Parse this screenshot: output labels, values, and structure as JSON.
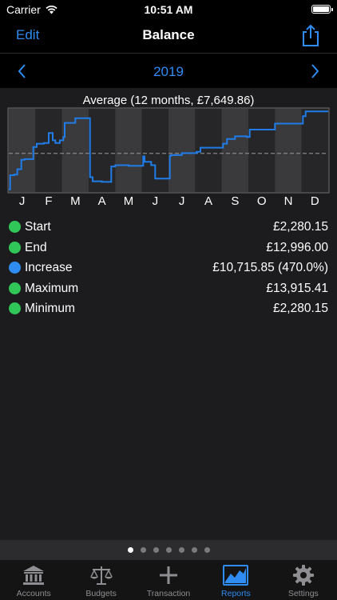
{
  "status": {
    "carrier": "Carrier",
    "time": "10:51 AM"
  },
  "nav": {
    "edit_label": "Edit",
    "title": "Balance"
  },
  "period": {
    "year": "2019"
  },
  "chart_data": {
    "type": "line",
    "title": "Average (12 months, £7,649.86)",
    "categories": [
      "J",
      "F",
      "M",
      "A",
      "M",
      "J",
      "J",
      "A",
      "S",
      "O",
      "N",
      "D"
    ],
    "ylim": [
      1900,
      14300
    ],
    "average": 7649.86,
    "grid": false,
    "x": [
      0,
      0.05,
      0.05,
      0.2,
      0.2,
      0.32,
      0.32,
      0.47,
      0.47,
      0.59,
      0.59,
      0.92,
      0.92,
      1.05,
      1.05,
      1.32,
      1.32,
      1.5,
      1.5,
      1.65,
      1.65,
      1.75,
      1.75,
      1.92,
      1.92,
      2.05,
      2.05,
      2.1,
      2.1,
      2.5,
      2.5,
      3.05,
      3.05,
      3.15,
      3.15,
      3.5,
      3.5,
      3.85,
      3.85,
      4.0,
      4.0,
      4.5,
      4.5,
      5.05,
      5.05,
      5.1,
      5.1,
      5.35,
      5.35,
      5.5,
      5.5,
      6.05,
      6.05,
      6.1,
      6.1,
      6.5,
      6.5,
      7.05,
      7.05,
      7.2,
      7.2,
      8.05,
      8.05,
      8.2,
      8.2,
      8.5,
      8.5,
      8.95,
      8.95,
      9.05,
      9.05,
      10.0,
      10.0,
      11.05,
      11.05,
      11.15,
      11.15,
      12.0
    ],
    "series": [
      {
        "values": [
          2280.15,
          2280.15,
          4400,
          4400,
          4500,
          4500,
          5300,
          5300,
          6700,
          6700,
          6800,
          6800,
          8600,
          8600,
          9100,
          9100,
          9200,
          9200,
          10700,
          10700,
          9600,
          9600,
          9200,
          9200,
          9600,
          9600,
          10100,
          10100,
          12200,
          12200,
          12900,
          12900,
          4100,
          4100,
          3500,
          3500,
          3400,
          3400,
          5700,
          5700,
          5900,
          5900,
          5800,
          5800,
          7200,
          7200,
          6400,
          6400,
          5900,
          5900,
          3900,
          3900,
          7300,
          7300,
          7400,
          7400,
          7700,
          7700,
          7900,
          7900,
          8500,
          8500,
          9100,
          9100,
          9800,
          9800,
          10200,
          10200,
          10100,
          10100,
          11200,
          11200,
          12100,
          12100,
          13200,
          13200,
          13915.41,
          13915.41,
          12996.0
        ]
      }
    ]
  },
  "stats": {
    "rows": [
      {
        "label": "Start",
        "value": "£2,280.15",
        "color": "#30c758"
      },
      {
        "label": "End",
        "value": "£12,996.00",
        "color": "#30c758"
      },
      {
        "label": "Increase",
        "value": "£10,715.85 (470.0%)",
        "color": "#2f8cf2"
      },
      {
        "label": "Maximum",
        "value": "£13,915.41",
        "color": "#30c758"
      },
      {
        "label": "Minimum",
        "value": "£2,280.15",
        "color": "#30c758"
      }
    ]
  },
  "pager": {
    "count": 7,
    "active": 0
  },
  "tabs": [
    {
      "label": "Accounts",
      "icon": "bank-icon"
    },
    {
      "label": "Budgets",
      "icon": "scales-icon"
    },
    {
      "label": "Transaction",
      "icon": "plus-icon"
    },
    {
      "label": "Reports",
      "icon": "chart-icon"
    },
    {
      "label": "Settings",
      "icon": "gear-icon"
    }
  ],
  "colors": {
    "accent": "#2f8cf2",
    "green": "#30c758",
    "inactive": "#8e8e93"
  }
}
